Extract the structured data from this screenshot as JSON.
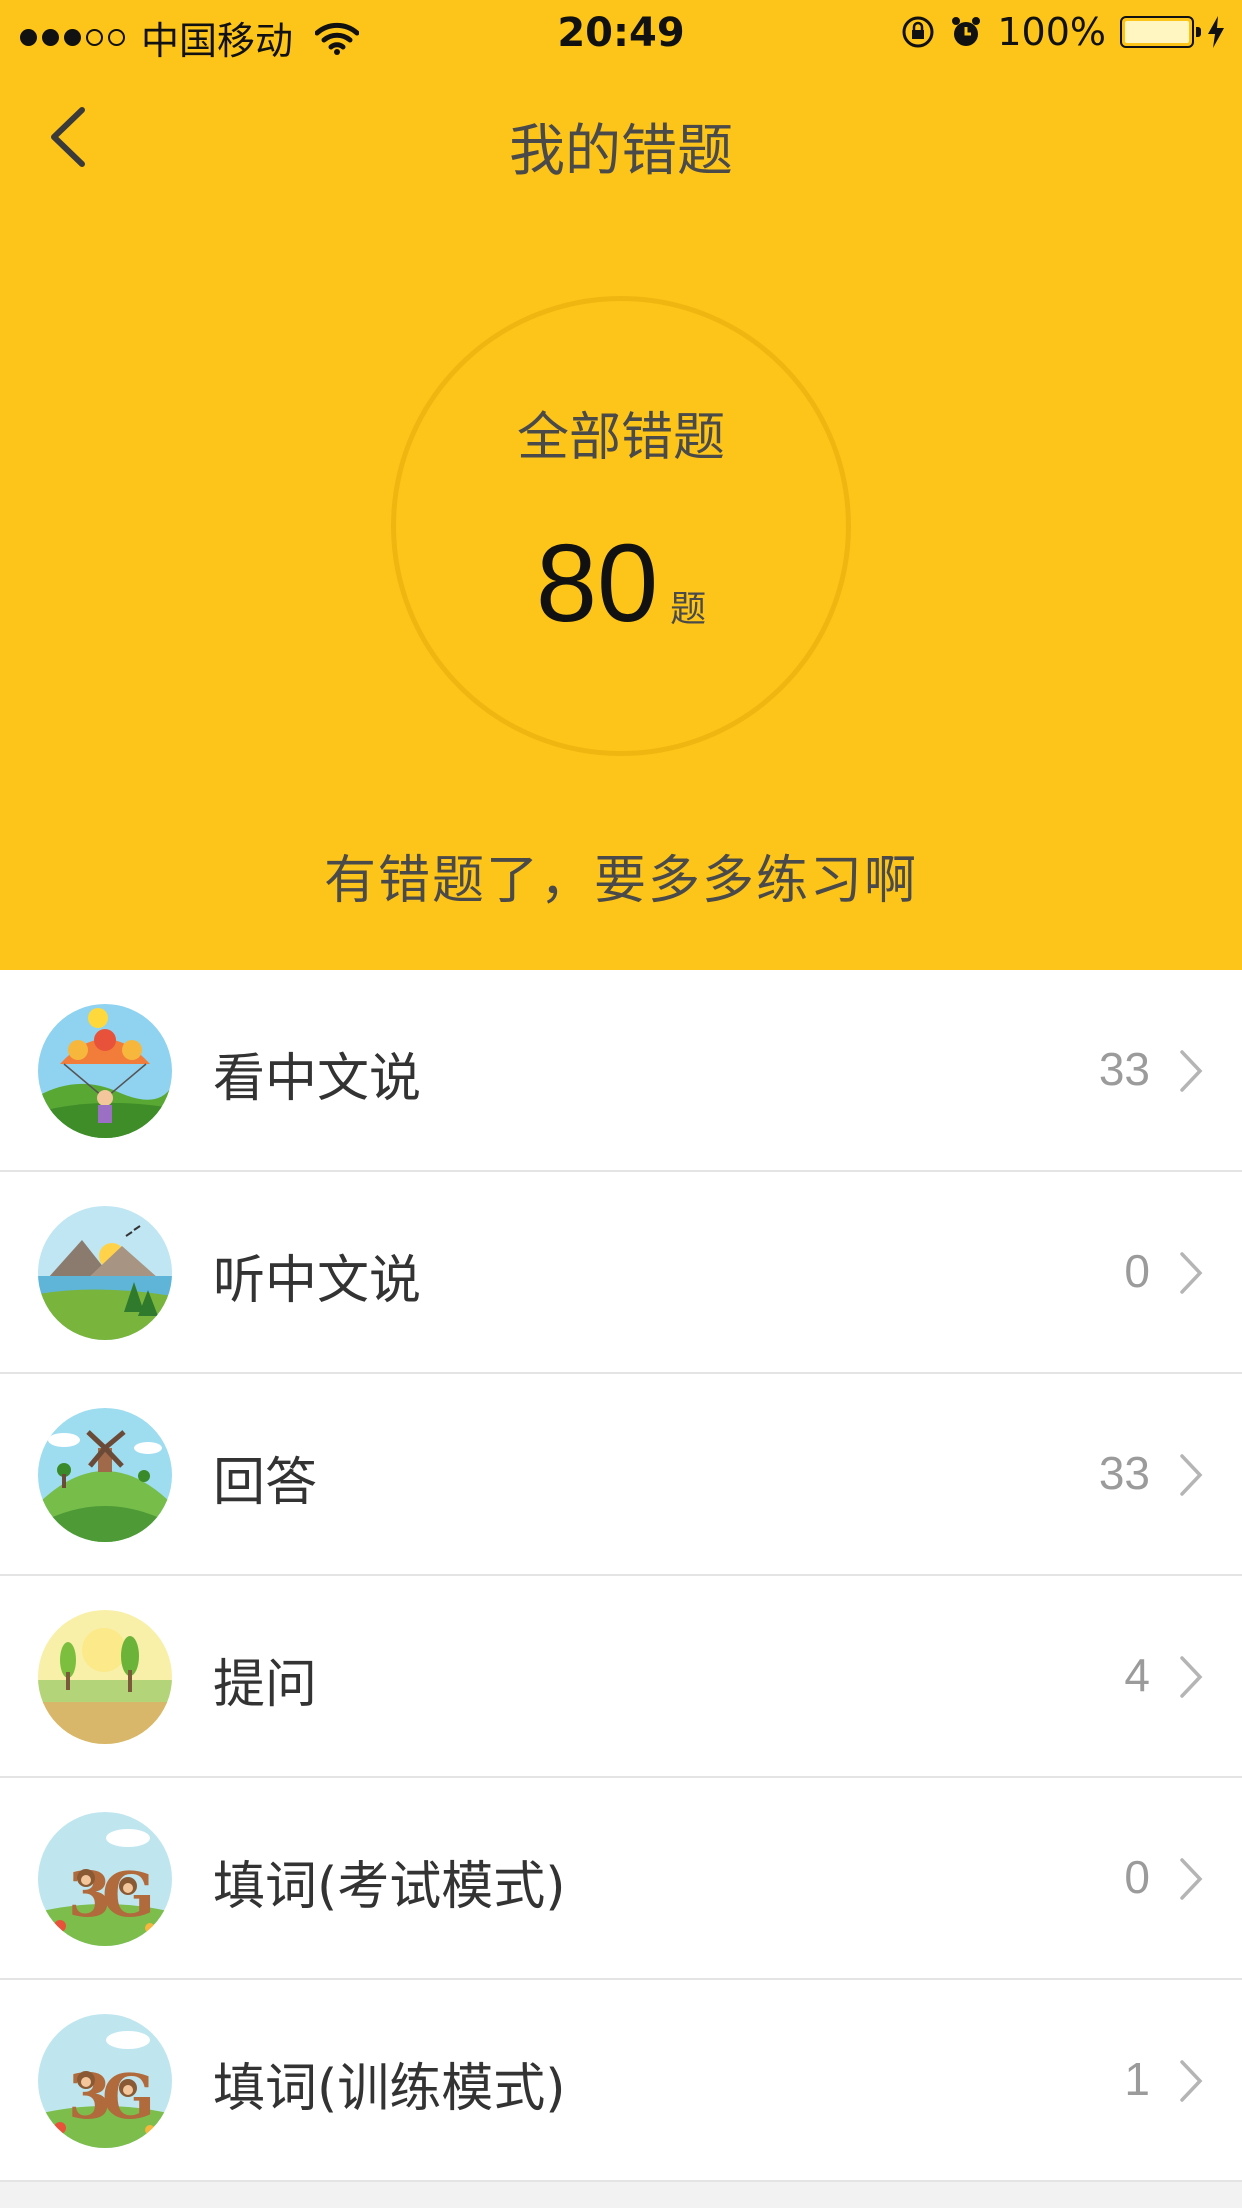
{
  "status_bar": {
    "carrier": "中国移动",
    "time": "20:49",
    "battery": "100%"
  },
  "nav": {
    "title": "我的错题"
  },
  "summary": {
    "label": "全部错题",
    "count": "80",
    "unit": "题",
    "tip": "有错题了，要多多练习啊"
  },
  "colors": {
    "header": "#fdc519",
    "ring": "#efb612"
  },
  "items": [
    {
      "label": "看中文说",
      "count": "33",
      "icon": "parachute-scene-icon"
    },
    {
      "label": "听中文说",
      "count": "0",
      "icon": "mountain-lake-scene-icon"
    },
    {
      "label": "回答",
      "count": "33",
      "icon": "windmill-hill-scene-icon"
    },
    {
      "label": "提问",
      "count": "4",
      "icon": "field-trees-scene-icon"
    },
    {
      "label": "填词(考试模式)",
      "count": "0",
      "icon": "monkeys-letters-scene-icon"
    },
    {
      "label": "填词(训练模式)",
      "count": "1",
      "icon": "monkeys-letters-scene-icon"
    }
  ]
}
